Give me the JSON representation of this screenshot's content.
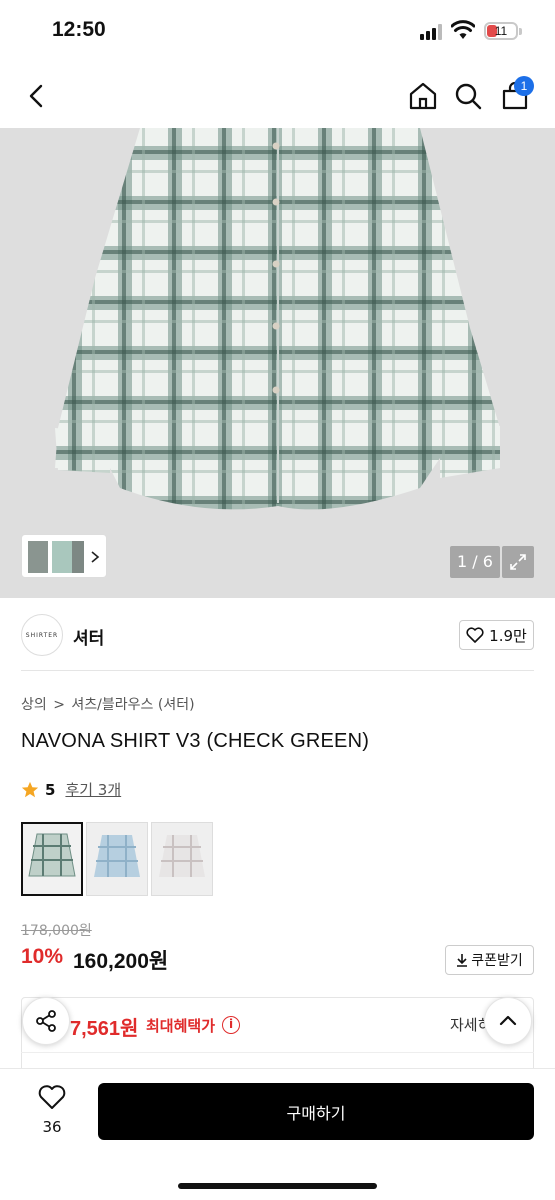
{
  "status": {
    "time": "12:50",
    "battery": "11"
  },
  "nav": {
    "cart_count": "1",
    "icons": [
      "back-icon",
      "home-icon",
      "search-icon",
      "cart-icon"
    ]
  },
  "gallery": {
    "counter": "1 / 6"
  },
  "brand": {
    "logo_text": "SHIRTER",
    "name": "셔터",
    "likes": "1.9만"
  },
  "breadcrumb": {
    "level1": "상의",
    "sep": ">",
    "level2": "셔츠/블라우스 (셔터)"
  },
  "product": {
    "title": "NAVONA SHIRT V3 (CHECK GREEN)",
    "rating": "5",
    "reviews": "후기 3개",
    "original_price": "178,000원",
    "discount": "10%",
    "price": "160,200원",
    "coupon_label": "쿠폰받기"
  },
  "benefit": {
    "price": "7,561원",
    "label": "최대혜택가",
    "info": "i",
    "detail": "자세히"
  },
  "bottom": {
    "wish_count": "36",
    "buy_label": "구매하기"
  },
  "colors": {
    "accent_red": "#e02b2b",
    "badge_blue": "#1c6fe8",
    "star": "#f5a623"
  }
}
